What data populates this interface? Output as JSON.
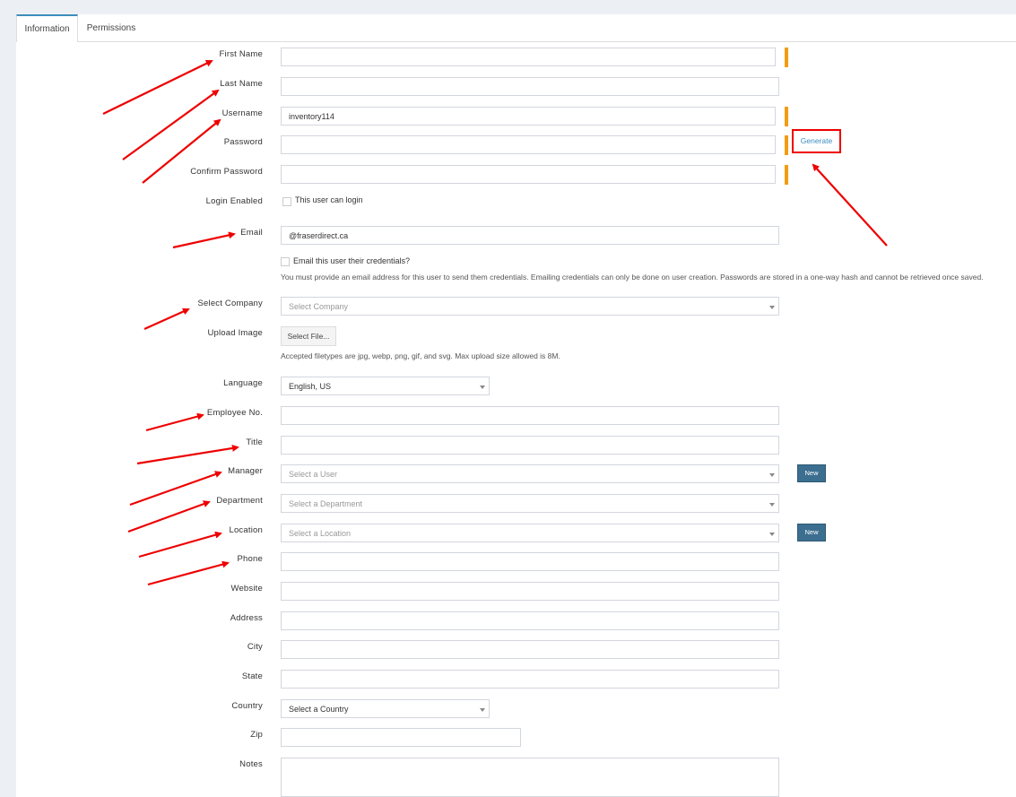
{
  "tabs": [
    {
      "label": "Information",
      "active": true
    },
    {
      "label": "Permissions",
      "active": false
    }
  ],
  "fields": {
    "first_name": {
      "label": "First Name",
      "value": ""
    },
    "last_name": {
      "label": "Last Name",
      "value": ""
    },
    "username": {
      "label": "Username",
      "value": "inventory114"
    },
    "password": {
      "label": "Password",
      "value": ""
    },
    "confirm_password": {
      "label": "Confirm Password",
      "value": ""
    },
    "login_enabled": {
      "label": "Login Enabled",
      "checkbox_label": "This user can login"
    },
    "email": {
      "label": "Email",
      "value": "@fraserdirect.ca",
      "checkbox_label": "Email this user their credentials?",
      "help": "You must provide an email address for this user to send them credentials. Emailing credentials can only be done on user creation. Passwords are stored in a one-way hash and cannot be retrieved once saved."
    },
    "company": {
      "label": "Select Company",
      "placeholder": "Select Company"
    },
    "upload_image": {
      "label": "Upload Image",
      "button": "Select File...",
      "help": "Accepted filetypes are jpg, webp, png, gif, and svg. Max upload size allowed is 8M."
    },
    "language": {
      "label": "Language",
      "value": "English, US"
    },
    "employee_no": {
      "label": "Employee No.",
      "value": ""
    },
    "title": {
      "label": "Title",
      "value": ""
    },
    "manager": {
      "label": "Manager",
      "placeholder": "Select a User"
    },
    "department": {
      "label": "Department",
      "placeholder": "Select a Department"
    },
    "location": {
      "label": "Location",
      "placeholder": "Select a Location"
    },
    "phone": {
      "label": "Phone",
      "value": ""
    },
    "website": {
      "label": "Website",
      "value": ""
    },
    "address": {
      "label": "Address",
      "value": ""
    },
    "city": {
      "label": "City",
      "value": ""
    },
    "state": {
      "label": "State",
      "value": ""
    },
    "country": {
      "label": "Country",
      "value": "Select a Country"
    },
    "zip": {
      "label": "Zip",
      "value": ""
    },
    "notes": {
      "label": "Notes",
      "value": ""
    }
  },
  "buttons": {
    "generate": "Generate",
    "new": "New"
  },
  "colors": {
    "accent": "#3c8dbc",
    "required": "#f39c12",
    "annotation": "#ee0000"
  }
}
